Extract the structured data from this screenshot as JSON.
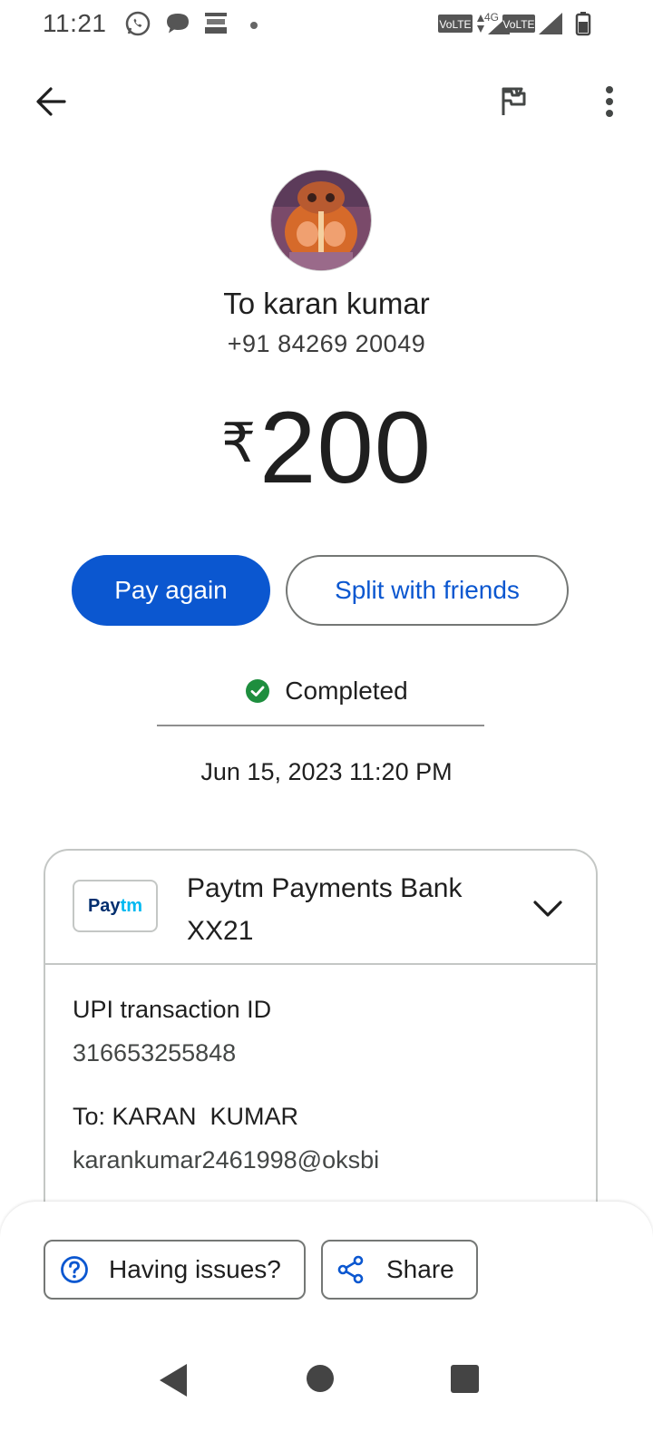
{
  "status_bar": {
    "time": "11:21",
    "icons": [
      "whatsapp-icon",
      "chat-bubble-icon",
      "news-app-icon",
      "dot-icon",
      "volte-icon",
      "4g-icon",
      "signal-icon",
      "battery-icon"
    ],
    "volte_label_1": "VoLTE",
    "network_label": "4G",
    "volte_label_2": "VoLTE"
  },
  "top_bar": {
    "back_icon": "arrow-back-icon",
    "flag_icon": "flag-icon",
    "more_icon": "more-vert-icon"
  },
  "recipient": {
    "name": "To karan kumar",
    "phone": "+91 84269 20049"
  },
  "payment": {
    "currency_symbol": "₹",
    "amount": "200"
  },
  "actions": {
    "pay_again_label": "Pay again",
    "split_label": "Split with friends"
  },
  "status": {
    "text": "Completed",
    "color": "#1e8e3e",
    "date_time": "Jun 15, 2023 11:20 PM"
  },
  "card": {
    "bank_logo_text_1": "Pay",
    "bank_logo_text_2": "tm",
    "bank_name_line1": "Paytm Payments Bank",
    "bank_name_line2": "XX21",
    "details": [
      {
        "label": "UPI transaction ID",
        "value": "316653255848"
      },
      {
        "label": "To: KARAN  KUMAR",
        "value": "karankumar2461998@oksbi"
      }
    ]
  },
  "bottom_actions": {
    "issues_label": "Having issues?",
    "share_label": "Share"
  },
  "colors": {
    "accent": "#0b57d0",
    "paytm_dark": "#002e6e",
    "paytm_light": "#00b9f1"
  }
}
